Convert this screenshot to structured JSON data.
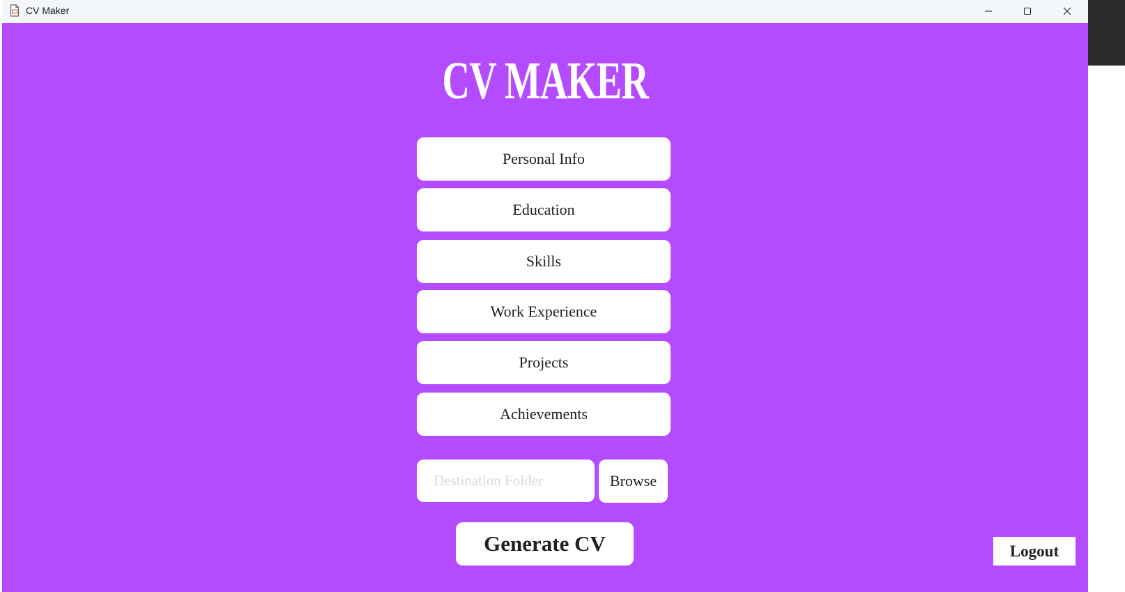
{
  "window": {
    "title": "CV Maker",
    "background_color": "#b54bff"
  },
  "heading": "CV MAKER",
  "menu": [
    {
      "label": "Personal Info"
    },
    {
      "label": "Education"
    },
    {
      "label": "Skills"
    },
    {
      "label": "Work Experience"
    },
    {
      "label": "Projects"
    },
    {
      "label": "Achievements"
    }
  ],
  "destination": {
    "value": "",
    "placeholder": "Destination Folder",
    "browse_label": "Browse"
  },
  "generate_label": "Generate CV",
  "logout_label": "Logout",
  "icons": {
    "app": "document-cv-icon",
    "minimize": "minimize-icon",
    "maximize": "maximize-icon",
    "close": "close-icon"
  }
}
